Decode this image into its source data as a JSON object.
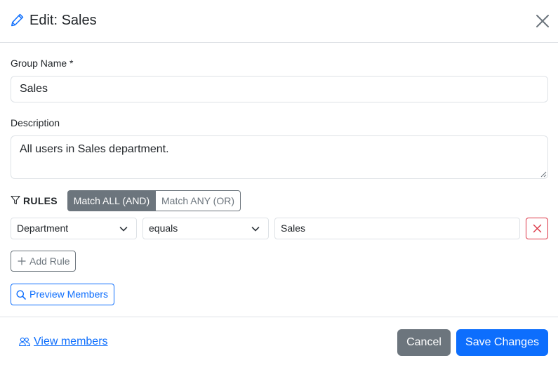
{
  "header": {
    "title": "Edit: Sales",
    "icon": "pencil-icon",
    "close_icon": "close-icon"
  },
  "form": {
    "group_name_label": "Group Name *",
    "group_name_value": "Sales",
    "description_label": "Description",
    "description_value": "All users in Sales department."
  },
  "rules": {
    "label": "RULES",
    "icon": "funnel-icon",
    "match_all_label": "Match ALL (AND)",
    "match_any_label": "Match ANY (OR)",
    "selected_match": "all",
    "items": [
      {
        "field": "Department",
        "operator": "equals",
        "value": "Sales"
      }
    ],
    "add_rule_label": "Add Rule",
    "preview_label": "Preview Members"
  },
  "footer": {
    "view_members_label": "View members",
    "cancel_label": "Cancel",
    "save_label": "Save Changes"
  },
  "colors": {
    "primary": "#0d6efd",
    "secondary": "#6c757d",
    "danger": "#dc3545",
    "border": "#dee2e6"
  }
}
